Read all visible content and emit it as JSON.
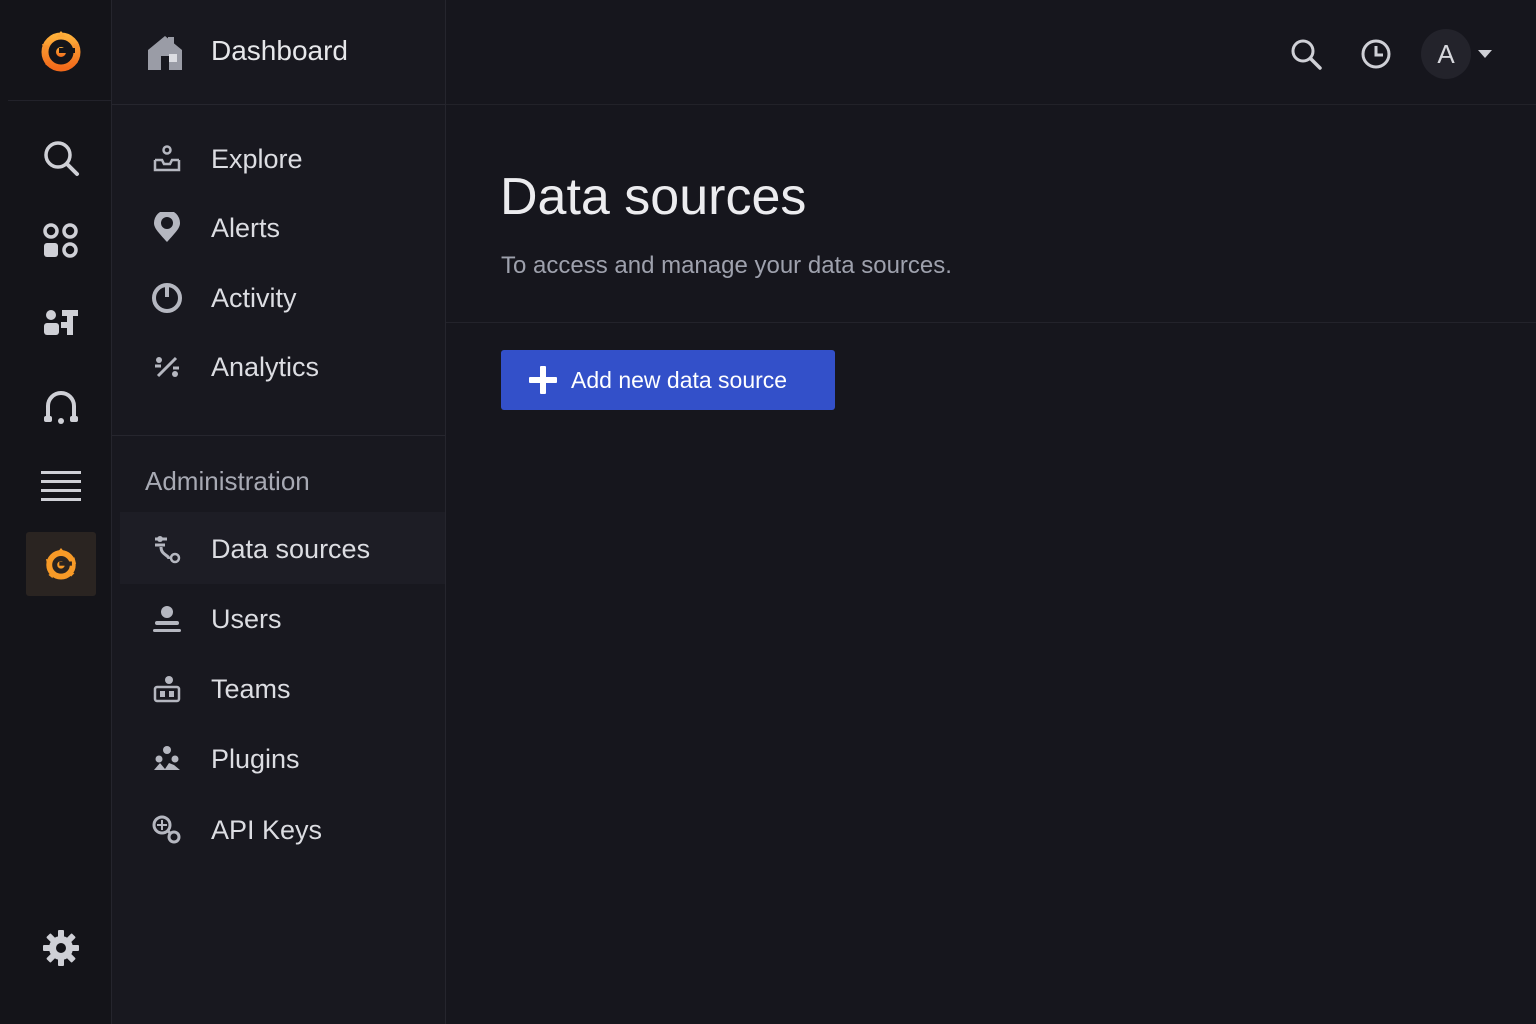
{
  "header": {
    "title": "Dashboard"
  },
  "nav": {
    "items": [
      {
        "label": "Explore",
        "icon": "explore-icon"
      },
      {
        "label": "Alerts",
        "icon": "alerts-icon"
      },
      {
        "label": "Activity",
        "icon": "activity-icon"
      },
      {
        "label": "Analytics",
        "icon": "analytics-icon"
      }
    ],
    "section_title": "Administration",
    "admin_items": [
      {
        "label": "Data sources",
        "icon": "data-sources-icon",
        "active": true
      },
      {
        "label": "Users",
        "icon": "users-icon"
      },
      {
        "label": "Teams",
        "icon": "teams-icon"
      },
      {
        "label": "Plugins",
        "icon": "plugins-icon"
      },
      {
        "label": "API Keys",
        "icon": "api-keys-icon"
      }
    ]
  },
  "rail": {
    "icons": [
      "grafana-logo-icon",
      "search-icon",
      "dashboards-icon",
      "apps-icon",
      "alerting-icon",
      "menu-icon",
      "grafana-active-icon",
      "settings-icon"
    ]
  },
  "topbar": {
    "avatar_initial": "A"
  },
  "main": {
    "title": "Data sources",
    "subtitle": "To access and manage your data sources.",
    "add_button_label": "Add new data source"
  },
  "colors": {
    "accent": "#3350c9",
    "brand": "#f79a27",
    "background": "#16161d"
  }
}
